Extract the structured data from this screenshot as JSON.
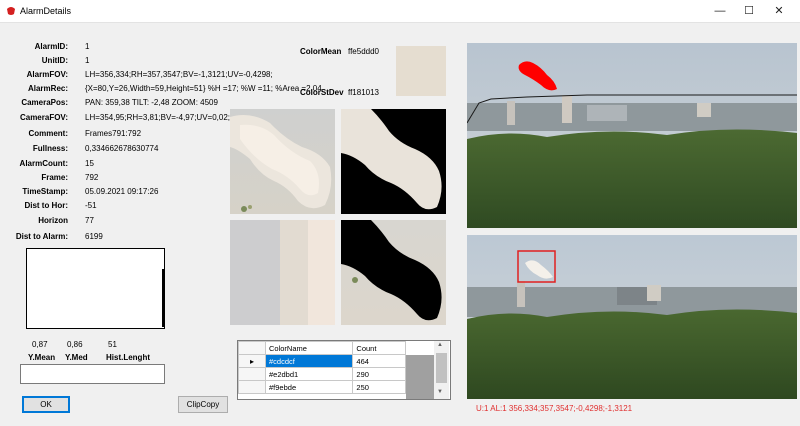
{
  "window": {
    "title": "AlarmDetails",
    "minimize": "—",
    "maximize": "☐",
    "close": "✕"
  },
  "fields": [
    {
      "label": "AlarmID:",
      "value": "1"
    },
    {
      "label": "UnitID:",
      "value": "1"
    },
    {
      "label": "AlarmFOV:",
      "value": "LH=356,334;RH=357,3547;BV=-1,3121;UV=-0,4298;"
    },
    {
      "label": "AlarmRec:",
      "value": "{X=80,Y=26,Width=59,Height=51} %H =17; %W =11; %Area =2,04"
    },
    {
      "label": "CameraPos:",
      "value": "PAN: 359,38 TILT: -2,48 ZOOM: 4509"
    },
    {
      "label": "CameraFOV:",
      "value": "LH=354,95;RH=3,81;BV=-4,97;UV=0,02;"
    },
    {
      "label": "Comment:",
      "value": "Frames791:792"
    },
    {
      "label": "Fullness:",
      "value": "0,334662678630774"
    },
    {
      "label": "AlarmCount:",
      "value": "15"
    },
    {
      "label": "Frame:",
      "value": "792"
    },
    {
      "label": "TimeStamp:",
      "value": "05.09.2021 09:17:26"
    },
    {
      "label": "Dist to Hor:",
      "value": "-51"
    },
    {
      "label": "Horizon",
      "value": "77"
    },
    {
      "label": "Dist to Alarm:",
      "value": "6199"
    }
  ],
  "color_mean": {
    "label": "ColorMean",
    "value": "ffe5ddd0",
    "swatch": "#e5ddd0"
  },
  "color_stdev": {
    "label": "ColorStDev",
    "value": "ff181013"
  },
  "histogram": {
    "y_mean": "0,87",
    "y_med": "0,86",
    "hist_length": "51",
    "y_mean_label": "Y.Mean",
    "y_med_label": "Y.Med",
    "hist_length_label": "Hist.Lenght"
  },
  "color_table": {
    "headers": [
      "ColorName",
      "Count"
    ],
    "rows": [
      {
        "name": "#cdcdcf",
        "count": "464",
        "selected": true
      },
      {
        "name": "#e2dbd1",
        "count": "290",
        "selected": false
      },
      {
        "name": "#f9ebde",
        "count": "250",
        "selected": false
      }
    ]
  },
  "buttons": {
    "ok": "OK",
    "clipcopy": "ClipCopy"
  },
  "status_overlay": "U:1 AL:1   356,334;357,3547;-0,4298;-1,3121",
  "colors": {
    "overlay_text": "#e03030",
    "selection": "#0078d7",
    "alarm_box": "#e02020",
    "smoke_red": "#ff0000"
  }
}
